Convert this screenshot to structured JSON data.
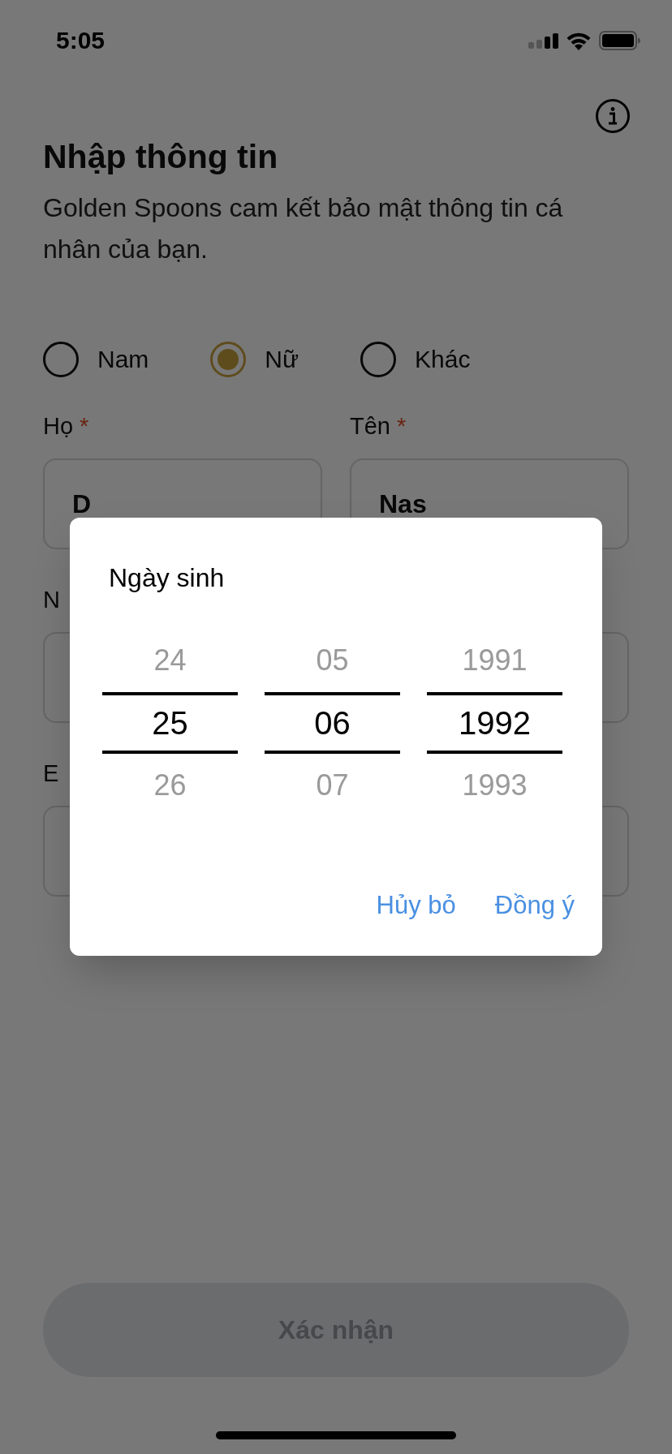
{
  "status_bar": {
    "time": "5:05"
  },
  "header": {
    "title": "Nhập thông tin",
    "subtitle": "Golden Spoons cam kết bảo mật thông tin cá nhân của bạn."
  },
  "gender": [
    {
      "label": "Nam",
      "selected": false
    },
    {
      "label": "Nữ",
      "selected": true
    },
    {
      "label": "Khác",
      "selected": false
    }
  ],
  "field_rows": [
    [
      {
        "label": "Họ",
        "required_mark": "*",
        "value": "D"
      },
      {
        "label": "Tên",
        "required_mark": "*",
        "value": "Nas"
      }
    ],
    [
      {
        "label": "N"
      }
    ],
    [
      {
        "label": "E"
      }
    ]
  ],
  "confirm_button": {
    "label": "Xác nhận",
    "disabled": true
  },
  "date_picker": {
    "title": "Ngày sinh",
    "columns": [
      {
        "items": [
          {
            "label": "24",
            "selected": false
          },
          {
            "label": "25",
            "selected": true
          },
          {
            "label": "26",
            "selected": false
          }
        ]
      },
      {
        "items": [
          {
            "label": "05",
            "selected": false
          },
          {
            "label": "06",
            "selected": true
          },
          {
            "label": "07",
            "selected": false
          }
        ]
      },
      {
        "items": [
          {
            "label": "1991",
            "selected": false
          },
          {
            "label": "1992",
            "selected": true
          },
          {
            "label": "1993",
            "selected": false
          }
        ]
      }
    ],
    "buttons": [
      {
        "label": "Hủy bỏ"
      },
      {
        "label": "Đồng ý"
      }
    ]
  }
}
